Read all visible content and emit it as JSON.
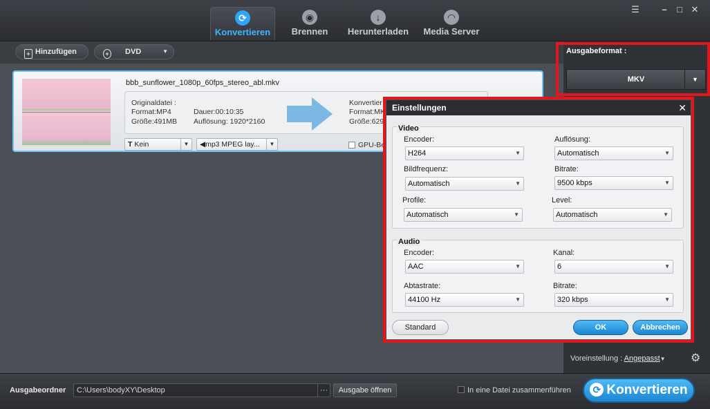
{
  "header": {
    "tabs": [
      {
        "label": "Konvertieren",
        "icon": "refresh-icon",
        "active": true
      },
      {
        "label": "Brennen",
        "icon": "disc-icon"
      },
      {
        "label": "Herunterladen",
        "icon": "download-icon"
      },
      {
        "label": "Media Server",
        "icon": "wifi-icon"
      }
    ]
  },
  "toolbar": {
    "add_label": "Hinzufügen",
    "dvd_label": "DVD"
  },
  "file": {
    "name": "bbb_sunflower_1080p_60fps_stereo_abl.mkv",
    "original_label": "Originaldatei :",
    "format": "Format:MP4",
    "size": "Größe:491MB",
    "duration": "Dauer:00:10:35",
    "resolution": "Auflösung: 1920*2160",
    "converted_label": "Konvertier",
    "converted_format": "Format:MK",
    "converted_size": "Größe:629",
    "subtitle": "Kein",
    "audio": "mp3 MPEG lay...",
    "gpu_label": "GPU-Be"
  },
  "right_panel": {
    "format_title": "Ausgabeformat :",
    "format_value": "MKV",
    "preset_label": "Voreinstellung :",
    "preset_value": "Angepasst"
  },
  "dialog": {
    "title": "Einstellungen",
    "video": {
      "title": "Video",
      "encoder_label": "Encoder:",
      "encoder_value": "H264",
      "resolution_label": "Auflösung:",
      "resolution_value": "Automatisch",
      "framerate_label": "Bildfrequenz:",
      "framerate_value": "Automatisch",
      "bitrate_label": "Bitrate:",
      "bitrate_value": "9500 kbps",
      "profile_label": "Profile:",
      "profile_value": "Automatisch",
      "level_label": "Level:",
      "level_value": "Automatisch"
    },
    "audio": {
      "title": "Audio",
      "encoder_label": "Encoder:",
      "encoder_value": "AAC",
      "channel_label": "Kanal:",
      "channel_value": "6",
      "samplerate_label": "Abtastrate:",
      "samplerate_value": "44100 Hz",
      "bitrate_label": "Bitrate:",
      "bitrate_value": "320 kbps"
    },
    "standard_label": "Standard",
    "ok_label": "OK",
    "cancel_label": "Abbrechen"
  },
  "bottom": {
    "output_label": "Ausgabeordner",
    "output_path": "C:\\Users\\bodyXY\\Desktop",
    "open_label": "Ausgabe öffnen",
    "merge_label": "In eine Datei zusammenführen",
    "convert_label": "Konvertieren"
  },
  "colors": {
    "accent": "#2ea6f7",
    "highlight": "#e3161d"
  }
}
